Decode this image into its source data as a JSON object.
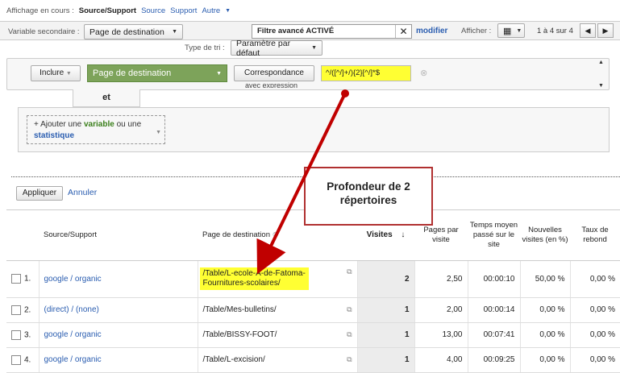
{
  "top": {
    "label": "Affichage en cours :",
    "current": "Source/Support",
    "links": [
      "Source",
      "Support",
      "Autre"
    ]
  },
  "toolbar": {
    "secondary_label": "Variable secondaire :",
    "secondary_value": "Page de destination",
    "filter_text": "Filtre avancé ACTIVÉ",
    "modify": "modifier",
    "display_label": "Afficher :",
    "pager": "1 à 4 sur 4"
  },
  "sort": {
    "label": "Type de tri :",
    "value": "Paramètre par défaut"
  },
  "filter": {
    "include": "Inclure",
    "dimension": "Page de destination",
    "match": "Correspondance",
    "match_sub": "avec expression",
    "regex": "^/([^/]+/){2}[^/]*$",
    "and": "et",
    "add_prefix": "+ Ajouter une",
    "add_variable": "variable",
    "add_or": "ou une",
    "add_stat": "statistique",
    "apply": "Appliquer",
    "cancel": "Annuler"
  },
  "annotation": {
    "line1": "Profondeur de 2",
    "line2": "répertoires"
  },
  "table": {
    "headers": {
      "source": "Source/Support",
      "page": "Page de destination",
      "visits": "Visites",
      "pages": "Pages par visite",
      "time": "Temps moyen passé sur le site",
      "new": "Nouvelles visites (en %)",
      "bounce": "Taux de rebond"
    },
    "rows": [
      {
        "idx": "1.",
        "source": "google / organic",
        "page1": "/Table/L-ecole-A-de-Fatoma-",
        "page2": "Fournitures-scolaires/",
        "visits": "2",
        "pages": "2,50",
        "time": "00:00:10",
        "new": "50,00 %",
        "bounce": "0,00 %"
      },
      {
        "idx": "2.",
        "source": "(direct) / (none)",
        "page1": "/Table/Mes-bulletins/",
        "page2": "",
        "visits": "1",
        "pages": "2,00",
        "time": "00:00:14",
        "new": "0,00 %",
        "bounce": "0,00 %"
      },
      {
        "idx": "3.",
        "source": "google / organic",
        "page1": "/Table/BISSY-FOOT/",
        "page2": "",
        "visits": "1",
        "pages": "13,00",
        "time": "00:07:41",
        "new": "0,00 %",
        "bounce": "0,00 %"
      },
      {
        "idx": "4.",
        "source": "google / organic",
        "page1": "/Table/L-excision/",
        "page2": "",
        "visits": "1",
        "pages": "4,00",
        "time": "00:09:25",
        "new": "0,00 %",
        "bounce": "0,00 %"
      }
    ]
  },
  "colors": {
    "highlight": "#ffff33",
    "accent_green": "#7da35a",
    "link": "#2a5db0",
    "annotation": "#c00000"
  }
}
